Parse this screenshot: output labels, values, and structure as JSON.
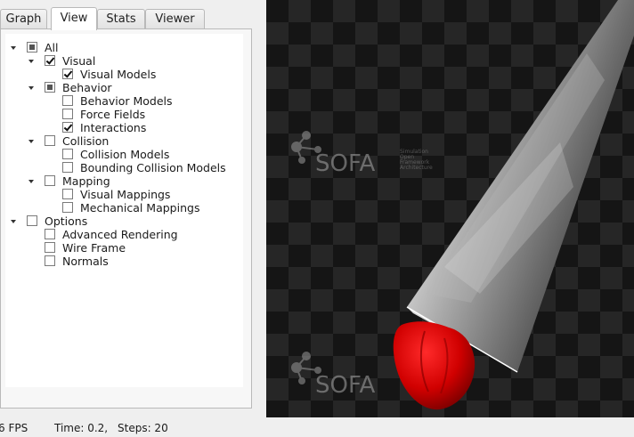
{
  "tabs": [
    "Graph",
    "View",
    "Stats",
    "Viewer"
  ],
  "active_tab": "View",
  "tree": [
    {
      "label": "All",
      "level": 0,
      "state": "partial",
      "expanded": true
    },
    {
      "label": "Visual",
      "level": 1,
      "state": "checked",
      "expanded": true
    },
    {
      "label": "Visual Models",
      "level": 2,
      "state": "checked"
    },
    {
      "label": "Behavior",
      "level": 1,
      "state": "partial",
      "expanded": true
    },
    {
      "label": "Behavior Models",
      "level": 2,
      "state": "unchecked"
    },
    {
      "label": "Force Fields",
      "level": 2,
      "state": "unchecked"
    },
    {
      "label": "Interactions",
      "level": 2,
      "state": "checked"
    },
    {
      "label": "Collision",
      "level": 1,
      "state": "unchecked",
      "expanded": true
    },
    {
      "label": "Collision Models",
      "level": 2,
      "state": "unchecked"
    },
    {
      "label": "Bounding Collision Models",
      "level": 2,
      "state": "unchecked"
    },
    {
      "label": "Mapping",
      "level": 1,
      "state": "unchecked",
      "expanded": true
    },
    {
      "label": "Visual Mappings",
      "level": 2,
      "state": "unchecked"
    },
    {
      "label": "Mechanical Mappings",
      "level": 2,
      "state": "unchecked"
    },
    {
      "label": "Options",
      "level": 0,
      "state": "unchecked",
      "expanded": true
    },
    {
      "label": "Advanced Rendering",
      "level": 1,
      "state": "unchecked"
    },
    {
      "label": "Wire Frame",
      "level": 1,
      "state": "unchecked"
    },
    {
      "label": "Normals",
      "level": 1,
      "state": "unchecked"
    }
  ],
  "viewer": {
    "watermark": "SOFA",
    "watermark_small": [
      "Simulation",
      "Open",
      "Framework",
      "Architecture"
    ],
    "background": "#151515",
    "object_color": "#d40000"
  },
  "status": {
    "fps": "6 FPS",
    "time": "Time: 0.2,",
    "steps": "Steps:  20"
  }
}
